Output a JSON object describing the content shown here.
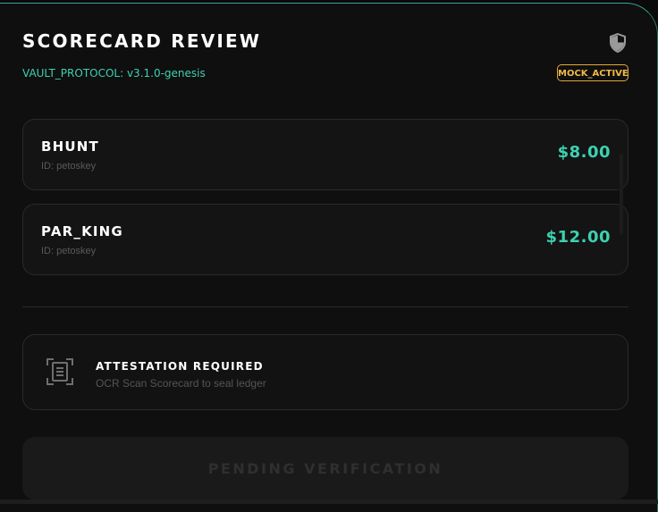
{
  "header": {
    "title": "SCORECARD REVIEW",
    "protocol": "VAULT_PROTOCOL: v3.1.0-genesis",
    "badge": "MOCK_ACTIVE",
    "shield_icon": "shield-icon"
  },
  "players": [
    {
      "name": "BHUNT",
      "id_label": "ID: petoskey",
      "amount": "$8.00"
    },
    {
      "name": "PAR_KING",
      "id_label": "ID: petoskey",
      "amount": "$12.00"
    }
  ],
  "attestation": {
    "icon": "scan-document-icon",
    "title": "ATTESTATION REQUIRED",
    "subtitle": "OCR Scan Scorecard to seal ledger"
  },
  "action": {
    "label": "PENDING VERIFICATION",
    "enabled": false
  },
  "colors": {
    "accent": "#3dd1b0",
    "badge": "#e2a93a",
    "background": "#0f0f0f",
    "card": "#141414"
  }
}
